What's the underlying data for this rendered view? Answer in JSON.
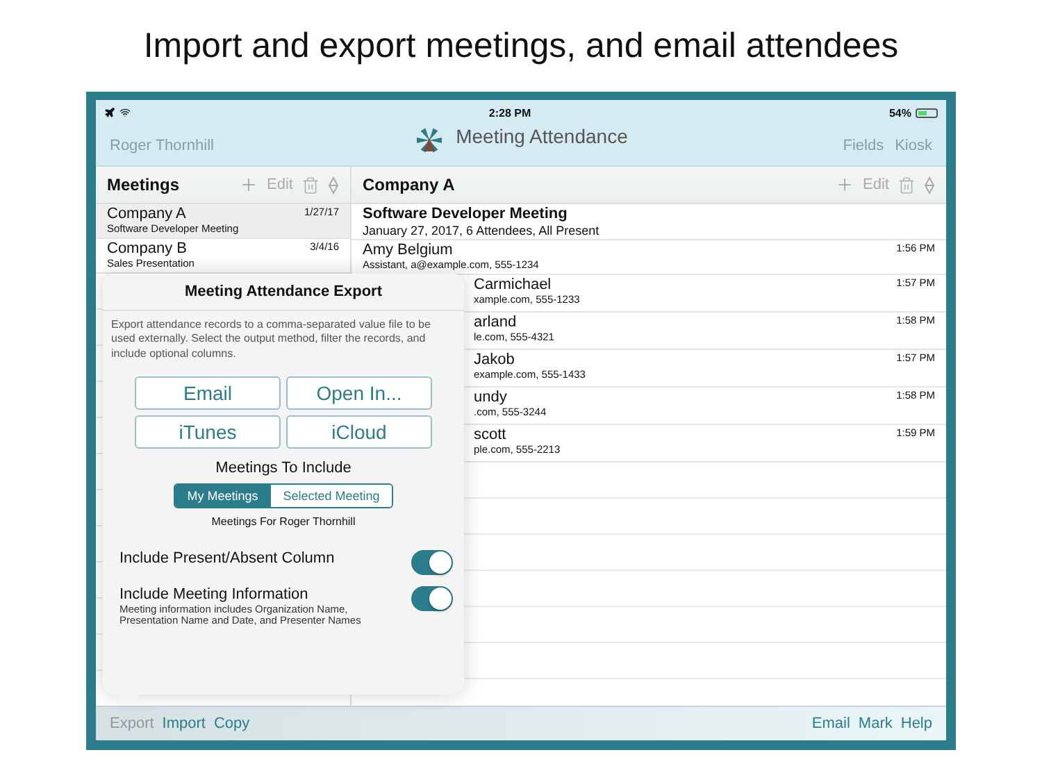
{
  "headline": "Import and export meetings, and email attendees",
  "status_bar": {
    "time": "2:28 PM",
    "battery": "54%"
  },
  "nav": {
    "user": "Roger Thornhill",
    "title": "Meeting Attendance",
    "actions": [
      "Fields",
      "Kiosk"
    ]
  },
  "meetings_pane": {
    "title": "Meetings",
    "edit": "Edit",
    "items": [
      {
        "name": "Company A",
        "subtitle": "Software Developer Meeting",
        "date": "1/27/17",
        "selected": true
      },
      {
        "name": "Company B",
        "subtitle": "Sales Presentation",
        "date": "3/4/16",
        "selected": false
      }
    ]
  },
  "detail_pane": {
    "title": "Company A",
    "edit": "Edit",
    "meeting_title": "Software Developer Meeting",
    "meeting_summary": "January 27, 2017, 6 Attendees, All Present",
    "attendees": [
      {
        "name": "Amy Belgium",
        "detail": "Assistant, a@example.com, 555-1234",
        "time": "1:56 PM"
      },
      {
        "name": "Carmichael",
        "detail": "xample.com, 555-1233",
        "time": "1:57 PM"
      },
      {
        "name": "arland",
        "detail": "le.com, 555-4321",
        "time": "1:58 PM"
      },
      {
        "name": "Jakob",
        "detail": "example.com, 555-1433",
        "time": "1:57 PM"
      },
      {
        "name": "undy",
        "detail": ".com, 555-3244",
        "time": "1:58 PM"
      },
      {
        "name": "scott",
        "detail": "ple.com, 555-2213",
        "time": "1:59 PM"
      }
    ]
  },
  "export_popover": {
    "title": "Meeting Attendance Export",
    "description": "Export attendance records to a comma-separated value file to be used externally.  Select the output method, filter the records, and include optional columns.",
    "methods": [
      "Email",
      "Open In...",
      "iTunes",
      "iCloud"
    ],
    "include_title": "Meetings To Include",
    "segments": [
      {
        "label": "My Meetings",
        "selected": true
      },
      {
        "label": "Selected Meeting",
        "selected": false
      }
    ],
    "filter_note": "Meetings For Roger Thornhill",
    "options": [
      {
        "label": "Include Present/Absent Column",
        "on": true
      },
      {
        "label": "Include Meeting Information",
        "note": "Meeting information includes Organization Name, Presentation Name and Date, and Presenter Names",
        "on": true
      }
    ]
  },
  "toolbar": {
    "left": [
      {
        "label": "Export",
        "selected": true
      },
      {
        "label": "Import",
        "selected": false
      },
      {
        "label": "Copy",
        "selected": false
      }
    ],
    "right": [
      "Email",
      "Mark",
      "Help"
    ]
  }
}
